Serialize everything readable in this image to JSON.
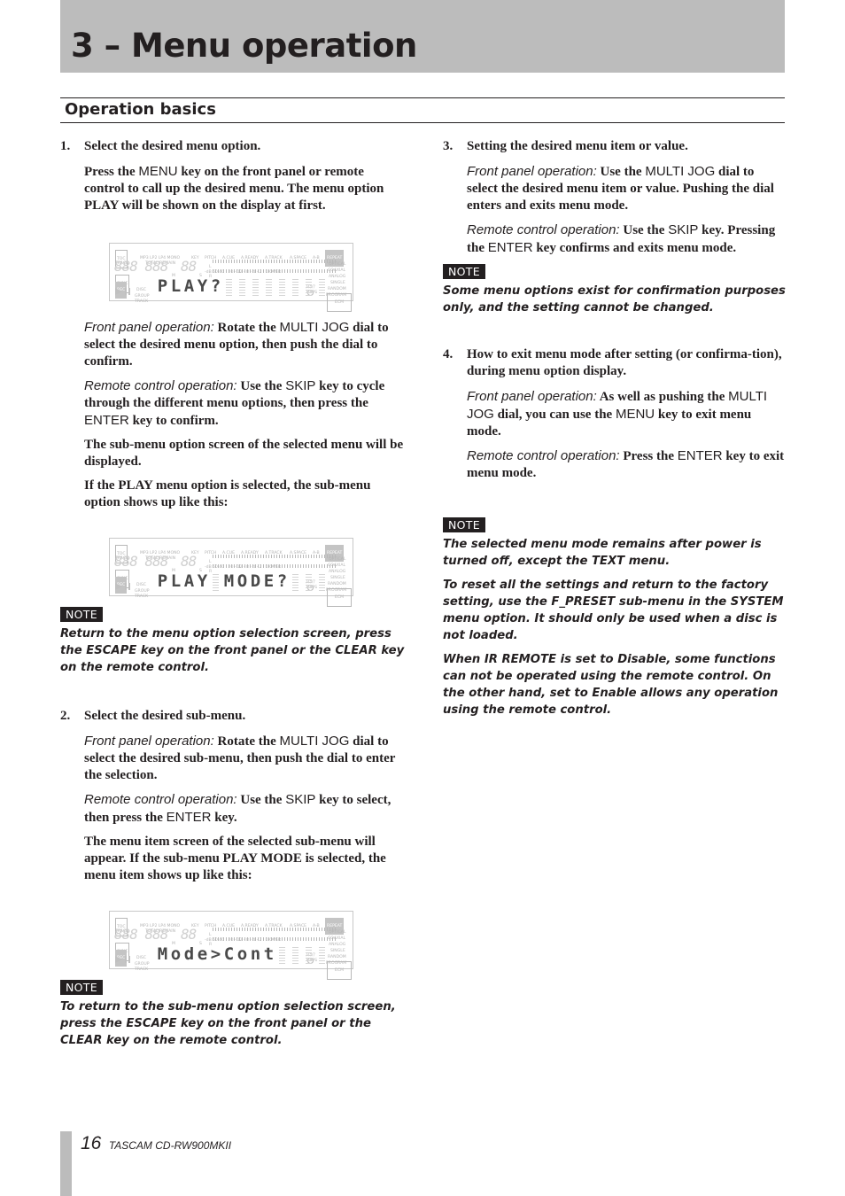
{
  "header": {
    "chapter_title": "3 – Menu operation",
    "section_title": "Operation basics"
  },
  "lcd_labels": {
    "toc": "TOC",
    "track": "TRACK",
    "formats": "MP3 LP2 LP4 MONO",
    "total_remain": "TOTAL REMAIN",
    "key": "KEY",
    "pitch": "PITCH",
    "a_cue": "A.CUE",
    "a_ready": "A.READY",
    "a_track": "A.TRACK",
    "a_space": "A.SPACE",
    "a_b": "A-B",
    "repeat": "REPEAT",
    "optical": "OPTICAL",
    "coaxial": "COAXIAL",
    "analog": "ANALOG",
    "single": "SINGLE",
    "random": "RANDOM",
    "program": "PROGRAM",
    "ecm": "ECM",
    "sync": "SYNC",
    "rec": "REC",
    "disc": "DISC",
    "group": "GROUP",
    "track2": "TRACK",
    "kana": "ｱｲｳ/ｱ",
    "caps": "CAPS",
    "segments": "888 888",
    "segments2": "88",
    "m": "M",
    "s": "S",
    "db_scale": "60 40 · 20 · 12 · 8 · 4 · 2 · 0 OVER",
    "l": "L",
    "r": "R",
    "db": "-dB"
  },
  "left_column": {
    "step1": {
      "num": "1.",
      "title": "Select the desired menu option.",
      "p1_a": "Press the ",
      "p1_key": "MENU",
      "p1_b": " key on the front panel or remote control to call up the desired menu. The menu option PLAY will be shown on the display at first.",
      "display1": [
        "P",
        "L",
        "A",
        "Y",
        "?"
      ],
      "front_label": "Front panel operation:",
      "front_a": " Rotate the ",
      "front_key": "MULTI JOG",
      "front_b": " dial to select the desired menu option, then push the dial to confirm.",
      "remote_label": "Remote control operation:",
      "remote_a": " Use the ",
      "remote_key1": "SKIP",
      "remote_b": " key to cycle through the different menu options, then press the ",
      "remote_key2": "ENTER",
      "remote_c": " key to confirm.",
      "p2": "The sub-menu option screen of the selected menu will be displayed.",
      "p3": "If the PLAY menu option is selected, the sub-menu option shows up like this:",
      "display2": [
        "P",
        "L",
        "A",
        "Y",
        "",
        "M",
        "O",
        "D",
        "E",
        "?"
      ],
      "note_label": "NOTE",
      "note_text": "Return to the menu option selection screen, press the ESCAPE key on the front panel or the CLEAR key on the remote control."
    },
    "step2": {
      "num": "2.",
      "title": "Select the desired sub-menu.",
      "front_label": "Front panel operation:",
      "front_a": " Rotate the ",
      "front_key": "MULTI JOG",
      "front_b": " dial to select the desired sub-menu, then push the dial to enter the selection.",
      "remote_label": "Remote control operation:",
      "remote_a": " Use the ",
      "remote_key1": "SKIP",
      "remote_b": " key to select, then press the ",
      "remote_key2": "ENTER",
      "remote_c": " key.",
      "p1": "The menu item screen of the selected sub-menu will appear. If the sub-menu PLAY MODE is selected, the menu item shows up like this:",
      "display3": [
        "M",
        "o",
        "d",
        "e",
        ">",
        "C",
        "o",
        "n",
        "t"
      ],
      "note_label": "NOTE",
      "note_text": "To return to the sub-menu option selection screen, press the ESCAPE key on the front panel or the CLEAR key on the remote control."
    }
  },
  "right_column": {
    "step3": {
      "num": "3.",
      "title": "Setting the desired menu item or value.",
      "front_label": "Front panel operation:",
      "front_a": " Use the ",
      "front_key": "MULTI JOG",
      "front_b": " dial to select the desired menu item or value. Pushing the dial enters and exits menu mode.",
      "remote_label": "Remote control operation:",
      "remote_a": " Use the ",
      "remote_key1": "SKIP",
      "remote_b": " key. Pressing the ",
      "remote_key2": "ENTER",
      "remote_c": " key confirms and exits menu mode.",
      "note_label": "NOTE",
      "note_text": "Some menu options exist for confirmation purposes only, and the setting cannot be changed."
    },
    "step4": {
      "num": "4.",
      "title": "How to exit menu mode after setting (or confirma-tion), during menu option display.",
      "front_label": "Front panel operation:",
      "front_a": " As well as pushing the ",
      "front_key1": "MULTI JOG",
      "front_b": " dial, you can use the ",
      "front_key2": "MENU",
      "front_c": " key to exit menu mode.",
      "remote_label": "Remote control operation:",
      "remote_a": " Press the ",
      "remote_key": "ENTER",
      "remote_b": " key to exit menu mode."
    },
    "notes": {
      "note_label": "NOTE",
      "n1": "The selected menu mode remains after power is turned off, except the TEXT menu.",
      "n2": "To reset all the settings and return to the factory setting, use the F_PRESET sub-menu in the SYSTEM menu option. It should only be used when a disc is not loaded.",
      "n3": "When IR REMOTE is set to Disable, some functions can not be operated using the remote control. On the other hand, set to Enable allows any operation using the remote control."
    }
  },
  "footer": {
    "page_number": "16",
    "model": "TASCAM  CD-RW900MKII"
  }
}
